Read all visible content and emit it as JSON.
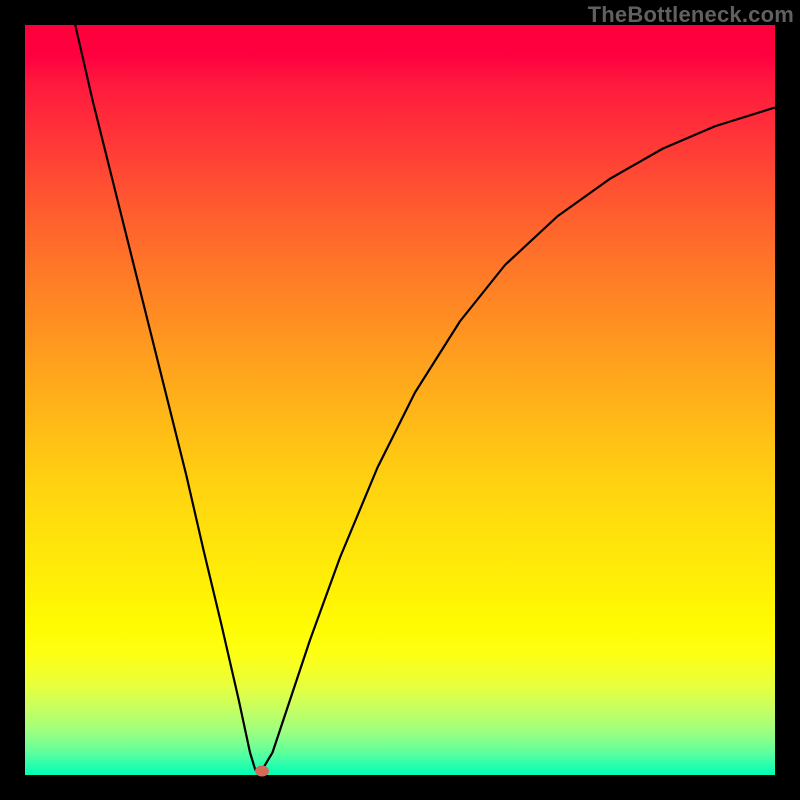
{
  "watermark": "TheBottleneck.com",
  "chart_data": {
    "type": "line",
    "title": "",
    "xlabel": "",
    "ylabel": "",
    "xlim": [
      0,
      100
    ],
    "ylim": [
      0,
      100
    ],
    "gradient_stops": [
      {
        "pct": 0,
        "color": "#ff003c"
      },
      {
        "pct": 30,
        "color": "#ff6f2a"
      },
      {
        "pct": 62,
        "color": "#ffd410"
      },
      {
        "pct": 84,
        "color": "#fdff14"
      },
      {
        "pct": 100,
        "color": "#00ffb6"
      }
    ],
    "series": [
      {
        "name": "bottleneck-curve",
        "points": [
          {
            "x": 6.7,
            "y": 100.0
          },
          {
            "x": 9.0,
            "y": 90.0
          },
          {
            "x": 11.5,
            "y": 80.0
          },
          {
            "x": 14.0,
            "y": 70.0
          },
          {
            "x": 16.5,
            "y": 60.0
          },
          {
            "x": 19.0,
            "y": 50.0
          },
          {
            "x": 21.5,
            "y": 40.0
          },
          {
            "x": 23.8,
            "y": 30.0
          },
          {
            "x": 26.2,
            "y": 20.0
          },
          {
            "x": 28.5,
            "y": 10.0
          },
          {
            "x": 30.0,
            "y": 3.0
          },
          {
            "x": 30.7,
            "y": 0.7
          },
          {
            "x": 31.5,
            "y": 0.5
          },
          {
            "x": 33.0,
            "y": 3.0
          },
          {
            "x": 35.0,
            "y": 9.0
          },
          {
            "x": 38.0,
            "y": 18.0
          },
          {
            "x": 42.0,
            "y": 29.0
          },
          {
            "x": 47.0,
            "y": 41.0
          },
          {
            "x": 52.0,
            "y": 51.0
          },
          {
            "x": 58.0,
            "y": 60.5
          },
          {
            "x": 64.0,
            "y": 68.0
          },
          {
            "x": 71.0,
            "y": 74.5
          },
          {
            "x": 78.0,
            "y": 79.5
          },
          {
            "x": 85.0,
            "y": 83.5
          },
          {
            "x": 92.0,
            "y": 86.5
          },
          {
            "x": 100.0,
            "y": 89.0
          }
        ]
      }
    ],
    "marker": {
      "x": 31.6,
      "y": 0.5,
      "color": "#d46a56"
    }
  }
}
